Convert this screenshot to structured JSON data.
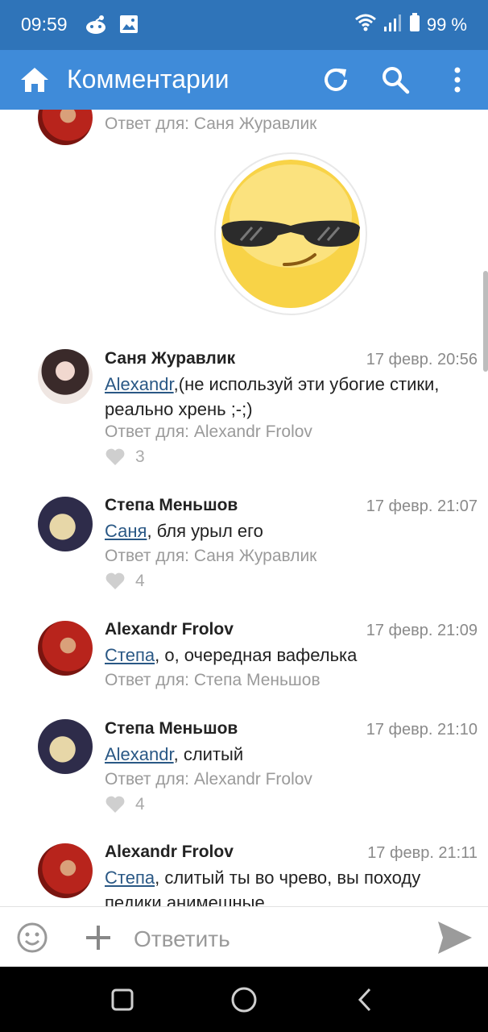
{
  "status_bar": {
    "time": "09:59",
    "battery": "99 %"
  },
  "app_bar": {
    "title": "Комментарии",
    "icons": [
      "home-icon",
      "refresh-icon",
      "search-icon",
      "more-vert-icon"
    ]
  },
  "top_partial": {
    "reply_to": "Ответ для: Саня Журавлик",
    "sticker": "sunglasses-smiley-sticker"
  },
  "comments": [
    {
      "author": "Саня Журавлик",
      "date": "17 февр. 20:56",
      "mention": "Alexandr",
      "text_line1": ",(не используй эти убогие стики,",
      "text_line2": "реально хрень ;-;)",
      "reply_to": "Ответ для: Alexandr Frolov",
      "likes": "3"
    },
    {
      "author": "Степа Меньшов",
      "date": "17 февр. 21:07",
      "mention": "Саня",
      "text_line1": ", бля урыл его",
      "reply_to": "Ответ для: Саня Журавлик",
      "likes": "4"
    },
    {
      "author": "Alexandr Frolov",
      "date": "17 февр. 21:09",
      "mention": "Степа",
      "text_line1": ", о, очередная вафелька",
      "reply_to": "Ответ для: Степа Меньшов"
    },
    {
      "author": "Степа Меньшов",
      "date": "17 февр. 21:10",
      "mention": "Alexandr",
      "text_line1": ", слитый",
      "reply_to": "Ответ для: Alexandr Frolov",
      "likes": "4"
    },
    {
      "author": "Alexandr Frolov",
      "date": "17 февр. 21:11",
      "mention": "Степа",
      "text_line1": ", слитый ты во чрево,  вы походу",
      "text_line2": "педики анимешные"
    }
  ],
  "compose": {
    "placeholder": "Ответить"
  },
  "colors": {
    "status_bar": "#2f74b9",
    "app_bar": "#3f8bd9",
    "link": "#2a5885",
    "muted": "#9a9a9a"
  }
}
